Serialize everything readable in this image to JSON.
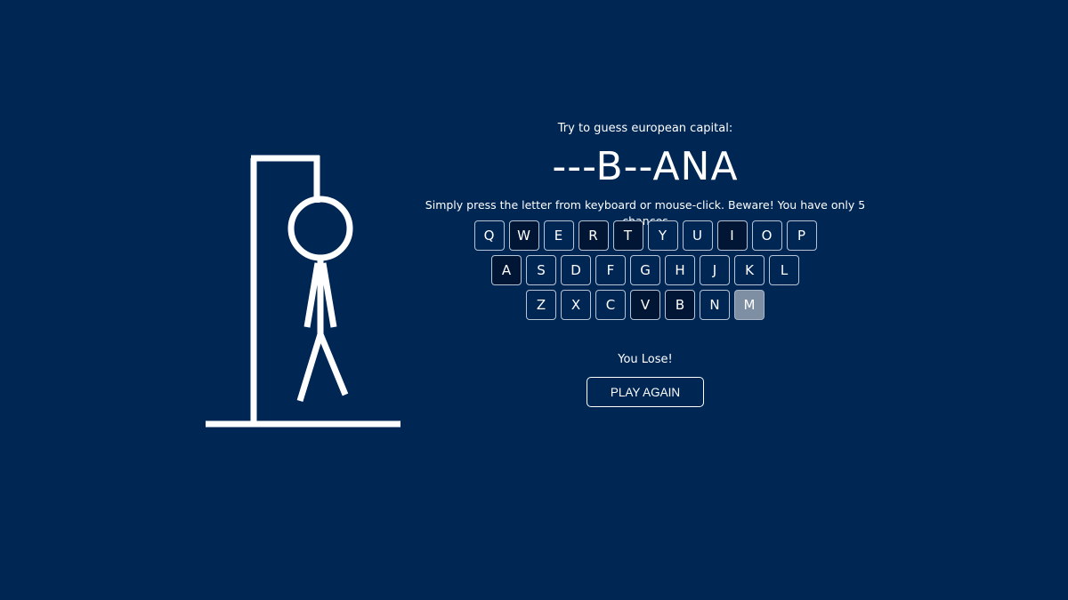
{
  "game": {
    "prompt": "Try to guess european capital:",
    "masked_word": "---B--ANA",
    "instructions": "Simply press the letter from keyboard or mouse-click. Beware! You have only 5 chances",
    "result": "You Lose!",
    "play_again_label": "PLAY AGAIN"
  },
  "keyboard": {
    "rows": [
      [
        {
          "letter": "Q",
          "state": "unused"
        },
        {
          "letter": "W",
          "state": "used"
        },
        {
          "letter": "E",
          "state": "unused"
        },
        {
          "letter": "R",
          "state": "used"
        },
        {
          "letter": "T",
          "state": "used"
        },
        {
          "letter": "Y",
          "state": "unused"
        },
        {
          "letter": "U",
          "state": "unused"
        },
        {
          "letter": "I",
          "state": "used"
        },
        {
          "letter": "O",
          "state": "unused"
        },
        {
          "letter": "P",
          "state": "unused"
        }
      ],
      [
        {
          "letter": "A",
          "state": "used"
        },
        {
          "letter": "S",
          "state": "unused"
        },
        {
          "letter": "D",
          "state": "unused"
        },
        {
          "letter": "F",
          "state": "unused"
        },
        {
          "letter": "G",
          "state": "unused"
        },
        {
          "letter": "H",
          "state": "unused"
        },
        {
          "letter": "J",
          "state": "unused"
        },
        {
          "letter": "K",
          "state": "unused"
        },
        {
          "letter": "L",
          "state": "unused"
        }
      ],
      [
        {
          "letter": "Z",
          "state": "unused"
        },
        {
          "letter": "X",
          "state": "unused"
        },
        {
          "letter": "C",
          "state": "unused"
        },
        {
          "letter": "V",
          "state": "used"
        },
        {
          "letter": "B",
          "state": "used"
        },
        {
          "letter": "N",
          "state": "unused"
        },
        {
          "letter": "M",
          "state": "current"
        }
      ]
    ]
  },
  "colors": {
    "background": "#002654",
    "key_used": "#011634",
    "key_current": "#7e8ea3",
    "drawing": "#ffffff"
  }
}
